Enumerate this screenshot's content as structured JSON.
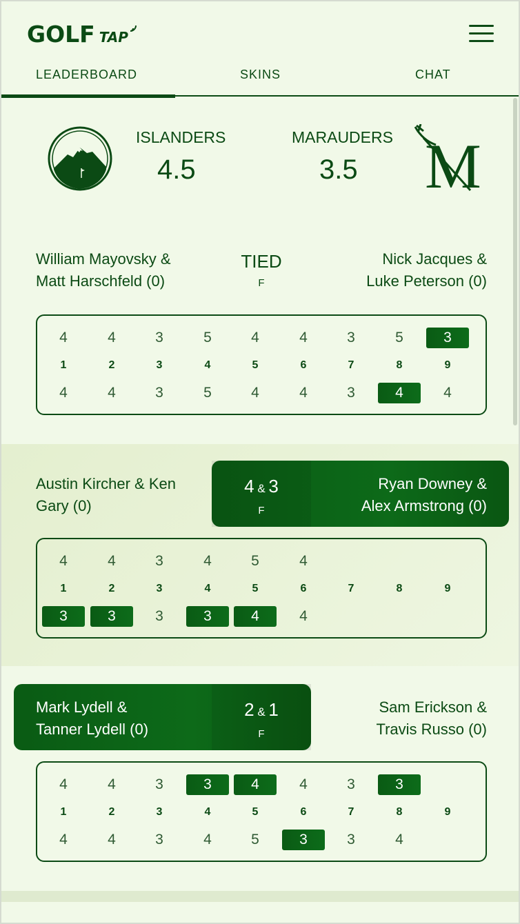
{
  "app": {
    "logo_main": "GOLF",
    "logo_sub": "TAP"
  },
  "tabs": [
    "LEADERBOARD",
    "SKINS",
    "CHAT"
  ],
  "teams": {
    "left": {
      "name": "ISLANDERS",
      "score": "4.5"
    },
    "right": {
      "name": "MARAUDERS",
      "score": "3.5"
    }
  },
  "holes": [
    "1",
    "2",
    "3",
    "4",
    "5",
    "6",
    "7",
    "8",
    "9"
  ],
  "matches": [
    {
      "left_names": [
        "William Mayovsky &",
        "Matt Harschfeld (0)"
      ],
      "right_names": [
        "Nick Jacques &",
        "Luke Peterson (0)"
      ],
      "status_main": "TIED",
      "status_amp": "",
      "status_main2": "",
      "status_sub": "F",
      "winner": "none",
      "top_scores": [
        "4",
        "4",
        "3",
        "5",
        "4",
        "4",
        "3",
        "5",
        "3"
      ],
      "top_wins": [
        false,
        false,
        false,
        false,
        false,
        false,
        false,
        false,
        true
      ],
      "bottom_scores": [
        "4",
        "4",
        "3",
        "5",
        "4",
        "4",
        "3",
        "4",
        "4"
      ],
      "bottom_wins": [
        false,
        false,
        false,
        false,
        false,
        false,
        false,
        true,
        false
      ]
    },
    {
      "left_names": [
        "Austin Kircher & Ken",
        "Gary (0)"
      ],
      "right_names": [
        "Ryan Downey &",
        "Alex Armstrong (0)"
      ],
      "status_main": "4",
      "status_amp": "&",
      "status_main2": "3",
      "status_sub": "F",
      "winner": "right",
      "top_scores": [
        "4",
        "4",
        "3",
        "4",
        "5",
        "4",
        "",
        "",
        ""
      ],
      "top_wins": [
        false,
        false,
        false,
        false,
        false,
        false,
        false,
        false,
        false
      ],
      "bottom_scores": [
        "3",
        "3",
        "3",
        "3",
        "4",
        "4",
        "",
        "",
        ""
      ],
      "bottom_wins": [
        true,
        true,
        false,
        true,
        true,
        false,
        false,
        false,
        false
      ]
    },
    {
      "left_names": [
        "Mark Lydell &",
        "Tanner Lydell (0)"
      ],
      "right_names": [
        "Sam Erickson &",
        "Travis Russo (0)"
      ],
      "status_main": "2",
      "status_amp": "&",
      "status_main2": "1",
      "status_sub": "F",
      "winner": "left",
      "top_scores": [
        "4",
        "4",
        "3",
        "3",
        "4",
        "4",
        "3",
        "3",
        ""
      ],
      "top_wins": [
        false,
        false,
        false,
        true,
        true,
        false,
        false,
        true,
        false
      ],
      "bottom_scores": [
        "4",
        "4",
        "3",
        "4",
        "5",
        "3",
        "3",
        "4",
        ""
      ],
      "bottom_wins": [
        false,
        false,
        false,
        false,
        false,
        true,
        false,
        false,
        false
      ]
    }
  ]
}
